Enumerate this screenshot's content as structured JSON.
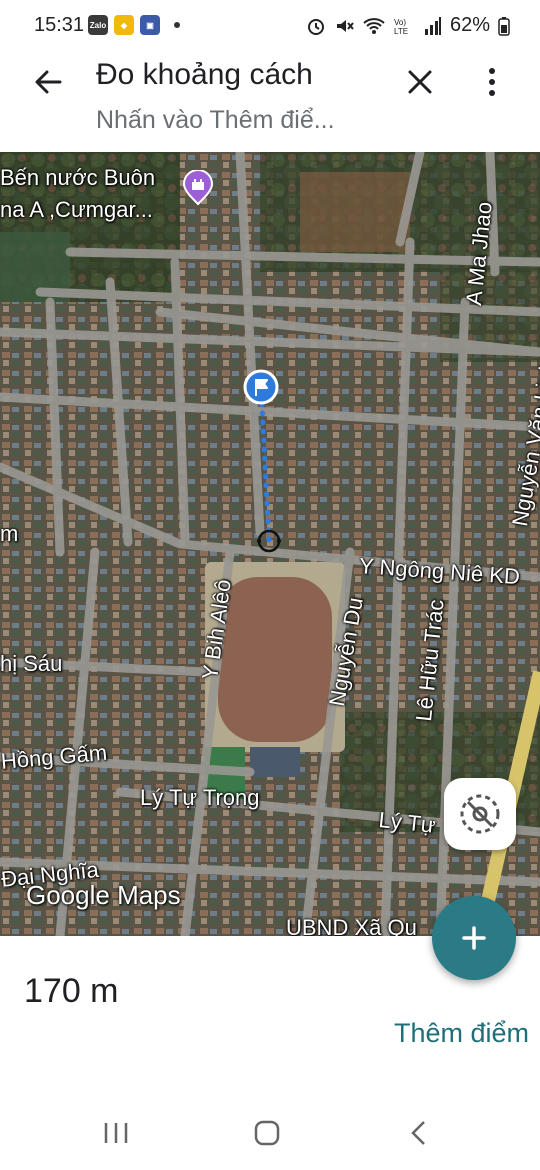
{
  "status_bar": {
    "time": "15:31",
    "app_icons": [
      "zalo-icon",
      "binance-icon",
      "app-icon"
    ],
    "battery": "62%"
  },
  "header": {
    "title": "Đo khoảng cách",
    "subtitle": "Nhấn vào Thêm điể..."
  },
  "map": {
    "labels": {
      "poi_name_line1": "Bến nước Buôn",
      "poi_name_line2": "na A ,Cưmgar...",
      "a_ma_jhao": "A Ma Jhao",
      "nguyen_van_linh": "Nguyễn Văn Linh",
      "m": "m",
      "y_ngong_nie": "Y Ngông Niê KD",
      "y_bih_aleo": "Y Bih Alêô",
      "nguyen_du": "Nguyễn Du",
      "le_huu_trac": "Lê Hữu Trác",
      "thi_sau": "hị Sáu",
      "hong_gam": "Hồng Gấm",
      "ly_tu_trong": "Lý Tự Trọng",
      "ly_tu_right": "Lý Tự",
      "dai_nghia": "Đại Nghĩa",
      "ubnd": "UBND Xã Qu"
    },
    "attribution": "Google Maps"
  },
  "panel": {
    "distance": "170 m",
    "add_point": "Thêm điểm"
  }
}
